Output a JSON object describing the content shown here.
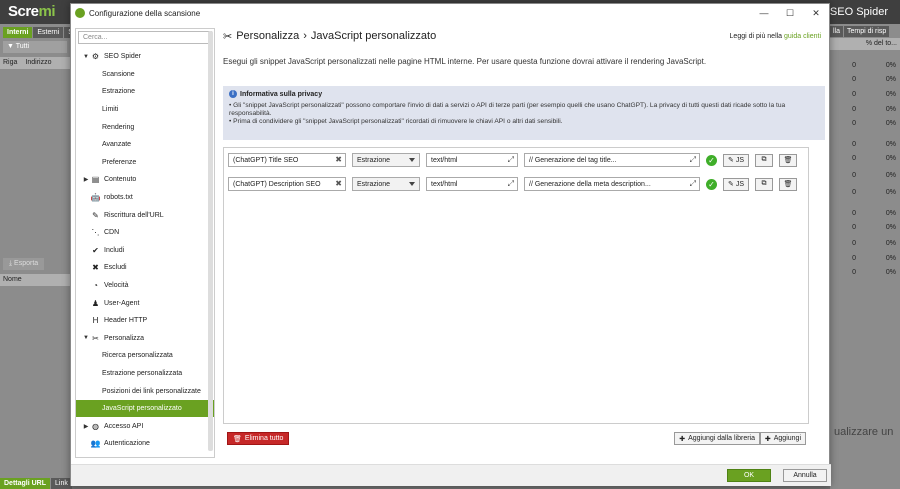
{
  "background_app": {
    "logo_text": "Scre",
    "logo_suffix": "mi",
    "product_name": "SEO Spider",
    "tabs": [
      "Interni",
      "Esterni",
      "S"
    ],
    "filter_label": "Tutti",
    "col_riga": "Riga",
    "col_indirizzo": "Indirizzo",
    "export_label": "Esporta",
    "col_nome": "Nome",
    "bottom_tabs": [
      "Dettagli URL",
      "Link"
    ],
    "right_headers": [
      "lla",
      "Tempi di risp"
    ],
    "right_subheader": "% del to...",
    "right_rows": [
      {
        "a": "0",
        "b": "0%"
      },
      {
        "a": "0",
        "b": "0%"
      },
      {
        "a": "0",
        "b": "0%"
      },
      {
        "a": "0",
        "b": "0%"
      },
      {
        "a": "0",
        "b": "0%"
      },
      {
        "a": "0",
        "b": "0%"
      },
      {
        "a": "0",
        "b": "0%"
      },
      {
        "a": "0",
        "b": "0%"
      },
      {
        "a": "0",
        "b": "0%"
      },
      {
        "a": "0",
        "b": "0%"
      },
      {
        "a": "0",
        "b": "0%"
      },
      {
        "a": "0",
        "b": "0%"
      },
      {
        "a": "0",
        "b": "0%"
      },
      {
        "a": "0",
        "b": "0%"
      }
    ],
    "hint_text": "ualizzare un"
  },
  "dialog": {
    "title": "Configurazione della scansione",
    "search_placeholder": "Cerca...",
    "tree": [
      {
        "label": "SEO Spider",
        "level": 0,
        "arrow": "▼",
        "icon": "gear-icon",
        "glyph": "⚙"
      },
      {
        "label": "Scansione",
        "level": 1
      },
      {
        "label": "Estrazione",
        "level": 1
      },
      {
        "label": "Limiti",
        "level": 1
      },
      {
        "label": "Rendering",
        "level": 1
      },
      {
        "label": "Avanzate",
        "level": 1
      },
      {
        "label": "Preferenze",
        "level": 1
      },
      {
        "label": "Contenuto",
        "level": 0,
        "arrow": "▶",
        "icon": "content-icon",
        "glyph": "▤"
      },
      {
        "label": "robots.txt",
        "level": 0,
        "icon": "robot-icon",
        "glyph": "🤖"
      },
      {
        "label": "Riscrittura dell'URL",
        "level": 0,
        "icon": "edit-icon",
        "glyph": "✎"
      },
      {
        "label": "CDN",
        "level": 0,
        "icon": "network-icon",
        "glyph": "⋱"
      },
      {
        "label": "Includi",
        "level": 0,
        "icon": "check-circle-icon",
        "glyph": "✔"
      },
      {
        "label": "Escludi",
        "level": 0,
        "icon": "exclude-circle-icon",
        "glyph": "✖"
      },
      {
        "label": "Velocità",
        "level": 0,
        "icon": "speed-icon",
        "glyph": "◔"
      },
      {
        "label": "User-Agent",
        "level": 0,
        "icon": "user-agent-icon",
        "glyph": "♟"
      },
      {
        "label": "Header HTTP",
        "level": 0,
        "icon": "header-icon",
        "glyph": "H"
      },
      {
        "label": "Personalizza",
        "level": 0,
        "arrow": "▼",
        "icon": "tools-icon",
        "glyph": "✂"
      },
      {
        "label": "Ricerca personalizzata",
        "level": 1
      },
      {
        "label": "Estrazione personalizzata",
        "level": 1
      },
      {
        "label": "Posizioni dei link personalizzate",
        "level": 1
      },
      {
        "label": "JavaScript personalizzato",
        "level": 1,
        "selected": true
      },
      {
        "label": "Accesso API",
        "level": 0,
        "arrow": "▶",
        "icon": "globe-icon",
        "glyph": "◍"
      },
      {
        "label": "Autenticazione",
        "level": 0,
        "icon": "users-icon",
        "glyph": "👥"
      }
    ],
    "breadcrumb": {
      "parent": "Personalizza",
      "separator": "›",
      "current": "JavaScript personalizzato"
    },
    "learn_more_prefix": "Leggi di più nella",
    "learn_more_link": "guida clienti",
    "description": "Esegui gli snippet JavaScript personalizzati nelle pagine HTML interne. Per usare questa funzione dovrai attivare il rendering JavaScript.",
    "privacy": {
      "title": "Informativa sulla privacy",
      "line1": "• Gli \"snippet JavaScript personalizzati\" possono comportare l'invio di dati a servizi o API di terze parti (per esempio quelli che usano ChatGPT). La privacy di tutti questi dati ricade sotto la tua responsabilità.",
      "line2": "• Prima di condividere gli \"snippet JavaScript personalizzati\" ricordati di rimuovere le chiavi API o altri dati sensibili."
    },
    "rows": [
      {
        "name": "(ChatGPT) Title SEO",
        "type": "Estrazione",
        "content_type": "text/html",
        "code": "// Generazione del tag title...",
        "js_label": "JS"
      },
      {
        "name": "(ChatGPT) Description SEO",
        "type": "Estrazione",
        "content_type": "text/html",
        "code": "// Generazione della meta description...",
        "js_label": "JS"
      }
    ],
    "delete_all_label": "Elimina tutto",
    "add_from_library_label": "Aggiungi dalla libreria",
    "add_label": "Aggiungi",
    "ok_label": "OK",
    "cancel_label": "Annulla"
  },
  "colors": {
    "accent": "#6aa121",
    "danger": "#c62828",
    "privacy_bg": "#dfe3ee",
    "valid": "#3fae29"
  }
}
